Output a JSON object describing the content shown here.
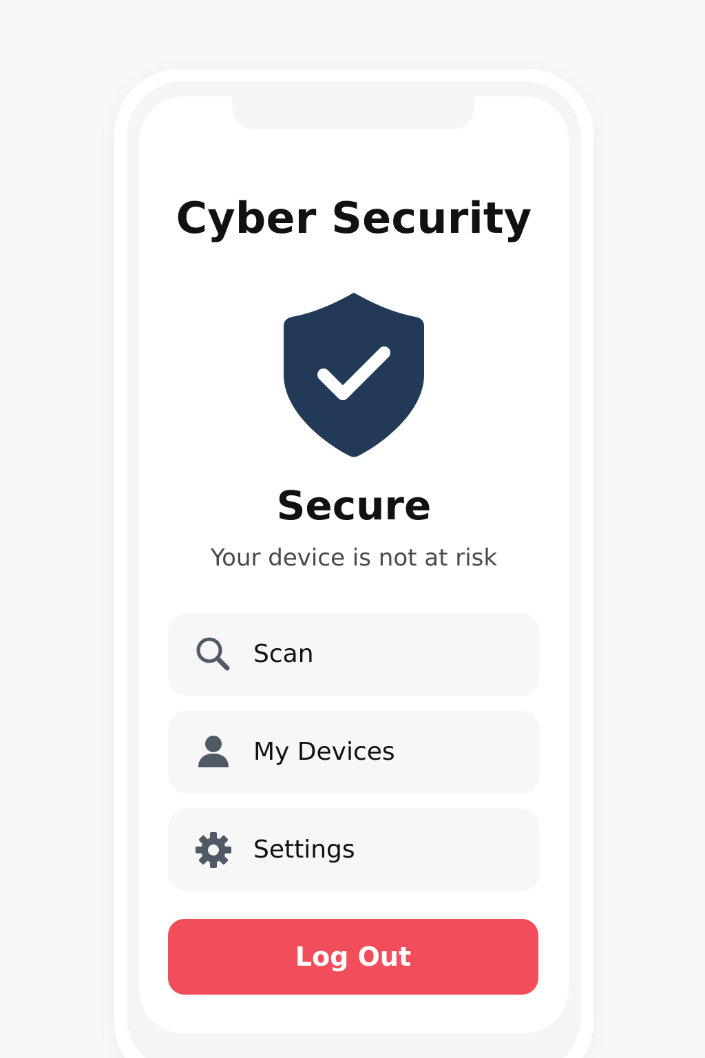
{
  "app": {
    "title": "Cyber Security"
  },
  "status": {
    "heading": "Secure",
    "message": "Your device is not at risk",
    "icon": "shield-check-icon"
  },
  "menu": {
    "items": [
      {
        "label": "Scan",
        "icon": "search-icon"
      },
      {
        "label": "My Devices",
        "icon": "user-icon"
      },
      {
        "label": "Settings",
        "icon": "gear-icon"
      }
    ]
  },
  "actions": {
    "logout_label": "Log Out"
  },
  "colors": {
    "shield": "#223a58",
    "logout": "#f24d5a",
    "icon": "#4f5a66",
    "menu_bg": "#f7f7f7"
  }
}
